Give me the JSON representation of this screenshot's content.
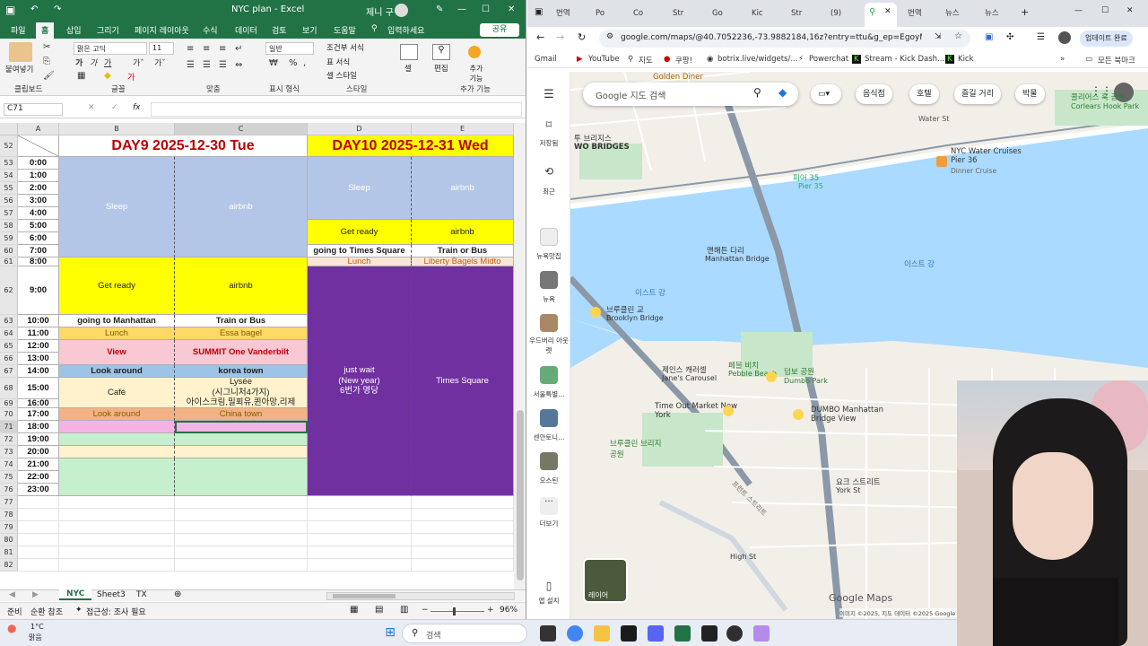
{
  "excel": {
    "title": "NYC plan  -  Excel",
    "user": "제니 구",
    "menu": [
      "파일",
      "홈",
      "삽입",
      "그리기",
      "페이지 레이아웃",
      "수식",
      "데이터",
      "검토",
      "보기",
      "도움말"
    ],
    "tell_me": "입력하세요",
    "share": "공유",
    "font_name": "맑은 고딕",
    "font_size": "11",
    "number_format": "일반",
    "ribbon_labels": {
      "paste": "붙여넣기",
      "clipboard": "클립보드",
      "font": "글꼴",
      "align": "맞춤",
      "number": "표시 형식",
      "style": "스타일",
      "cond_format": "조건부 서식",
      "table_format": "표 서식",
      "cell_style": "셀 스타일",
      "cells": "셀",
      "edit": "편집",
      "add": "추가 기능",
      "add_group": "추가 기능",
      "percent": "%"
    },
    "name_box": "C71",
    "fx": "fx",
    "columns": [
      "A",
      "B",
      "C",
      "D",
      "E"
    ],
    "rows": [
      "52",
      "53",
      "54",
      "55",
      "56",
      "57",
      "58",
      "59",
      "60",
      "61",
      "62",
      "63",
      "64",
      "65",
      "66",
      "67",
      "68",
      "69",
      "70",
      "71",
      "72",
      "73",
      "74",
      "75",
      "76",
      "77",
      "78",
      "79",
      "80",
      "81",
      "82"
    ],
    "times": [
      "0:00",
      "1:00",
      "2:00",
      "3:00",
      "4:00",
      "5:00",
      "6:00",
      "7:00",
      "8:00",
      "9:00",
      "10:00",
      "11:00",
      "12:00",
      "13:00",
      "14:00",
      "15:00",
      "16:00",
      "17:00",
      "18:00",
      "19:00",
      "20:00",
      "21:00",
      "22:00",
      "23:00"
    ],
    "day9_header": "DAY9   2025-12-30 Tue",
    "day10_header": "DAY10   2025-12-31 Wed",
    "day9": {
      "sleep": "Sleep",
      "sleep_place": "airbnb",
      "ready": "Get ready",
      "ready_place": "airbnb",
      "go": "going to Manhattan",
      "go_how": "Train or Bus",
      "lunch": "Lunch",
      "lunch_place": "Essa bagel",
      "view": "View",
      "view_place": "SUMMIT One Vanderbilt",
      "look": "Look around",
      "look_place": "korea town",
      "cafe": "Café",
      "cafe_place_1": "Lysée",
      "cafe_place_2": "(시그니처4가지)",
      "cafe_place_3": "아이스크림,밀푀유,퀸아망,리제",
      "look2": "Look around",
      "look2_place": "China town"
    },
    "day10": {
      "sleep": "Sleep",
      "sleep_place": "airbnb",
      "ready": "Get ready",
      "ready_place": "airbnb",
      "go": "going to Times Square",
      "go_how": "Train or Bus",
      "lunch": "Lunch",
      "lunch_place": "Liberty Bagels Midto",
      "wait_1": "just wait",
      "wait_2": "(New year)",
      "wait_3": "6번가 명당",
      "wait_place": "Times Square"
    },
    "sheets": [
      "NYC",
      "Sheet3",
      "TX"
    ],
    "status_ready": "준비",
    "status_circ": "순환 참조",
    "status_access": "접근성: 조사 필요",
    "zoom": "96%"
  },
  "chrome": {
    "tabs": [
      "번역",
      "Po",
      "Co",
      "Str",
      "Go",
      "Kic",
      "Str",
      "(9)",
      "",
      "번역",
      "뉴스",
      "뉴스"
    ],
    "url": "google.com/maps/@40.7052236,-73.9882184,16z?entry=ttu&g_ep=EgoyMDI1",
    "update_btn": "업데이트 완료",
    "bookmarks": [
      "Gmail",
      "YouTube",
      "지도",
      "쿠팡!",
      "botrix.live/widgets/...",
      "Powerchat",
      "Stream - Kick Dash...",
      "Kick"
    ],
    "all_bookmarks": "모든 북마크",
    "sidebar": [
      "저장됨",
      "최근",
      "뉴욕맛집",
      "뉴욕",
      "우드버리 아웃렛",
      "서울특별...",
      "센안토니...",
      "오스틴",
      "더보기",
      "앱 설치"
    ],
    "search_placeholder": "Google 지도 검색",
    "chips": [
      "음식점",
      "호텔",
      "즐길 거리",
      "박물"
    ],
    "map_labels": {
      "two_bridges_ko": "투 브리지스",
      "two_bridges": "WO BRIDGES",
      "golden": "Golden Diner",
      "corlears_ko": "콜리어스 훅 공원",
      "corlears": "Corlears Hook Park",
      "water": "Water St",
      "pier36": "NYC Water Cruises Pier 36",
      "pier36_sub": "Dinner Cruise",
      "pier35_ko": "피어 35",
      "pier35": "Pier 35",
      "manh_ko": "맨해튼 다리",
      "manh": "Manhattan Bridge",
      "east_river_1": "이스트 강",
      "east_river_2": "이스트 강",
      "bk_bridge_ko": "브루클린 교",
      "bk_bridge": "Brooklyn Bridge",
      "carousel_ko": "제인스 캐러셀",
      "carousel": "Jane's Carousel",
      "pebble_ko": "페블 비치",
      "pebble": "Pebble Beach",
      "dumbo_park_ko": "덤보 공원",
      "dumbo_park": "Dumbo Park",
      "timeout": "Time Out Market New York",
      "dumbo_view": "DUMBO Manhattan Bridge View",
      "bk_park_ko": "브루클린 브리지 공원",
      "york": "요크 스트리트",
      "york_en": "York St",
      "high": "High St",
      "front": "프런트 스트리트",
      "layer": "레이어",
      "google": "Google Maps",
      "footer": "이미지 ©2025, 지도 데이터 ©2025 Google   대한민국   약관"
    }
  },
  "taskbar": {
    "temp": "1°C",
    "weather": "맑음",
    "search": "검색"
  }
}
